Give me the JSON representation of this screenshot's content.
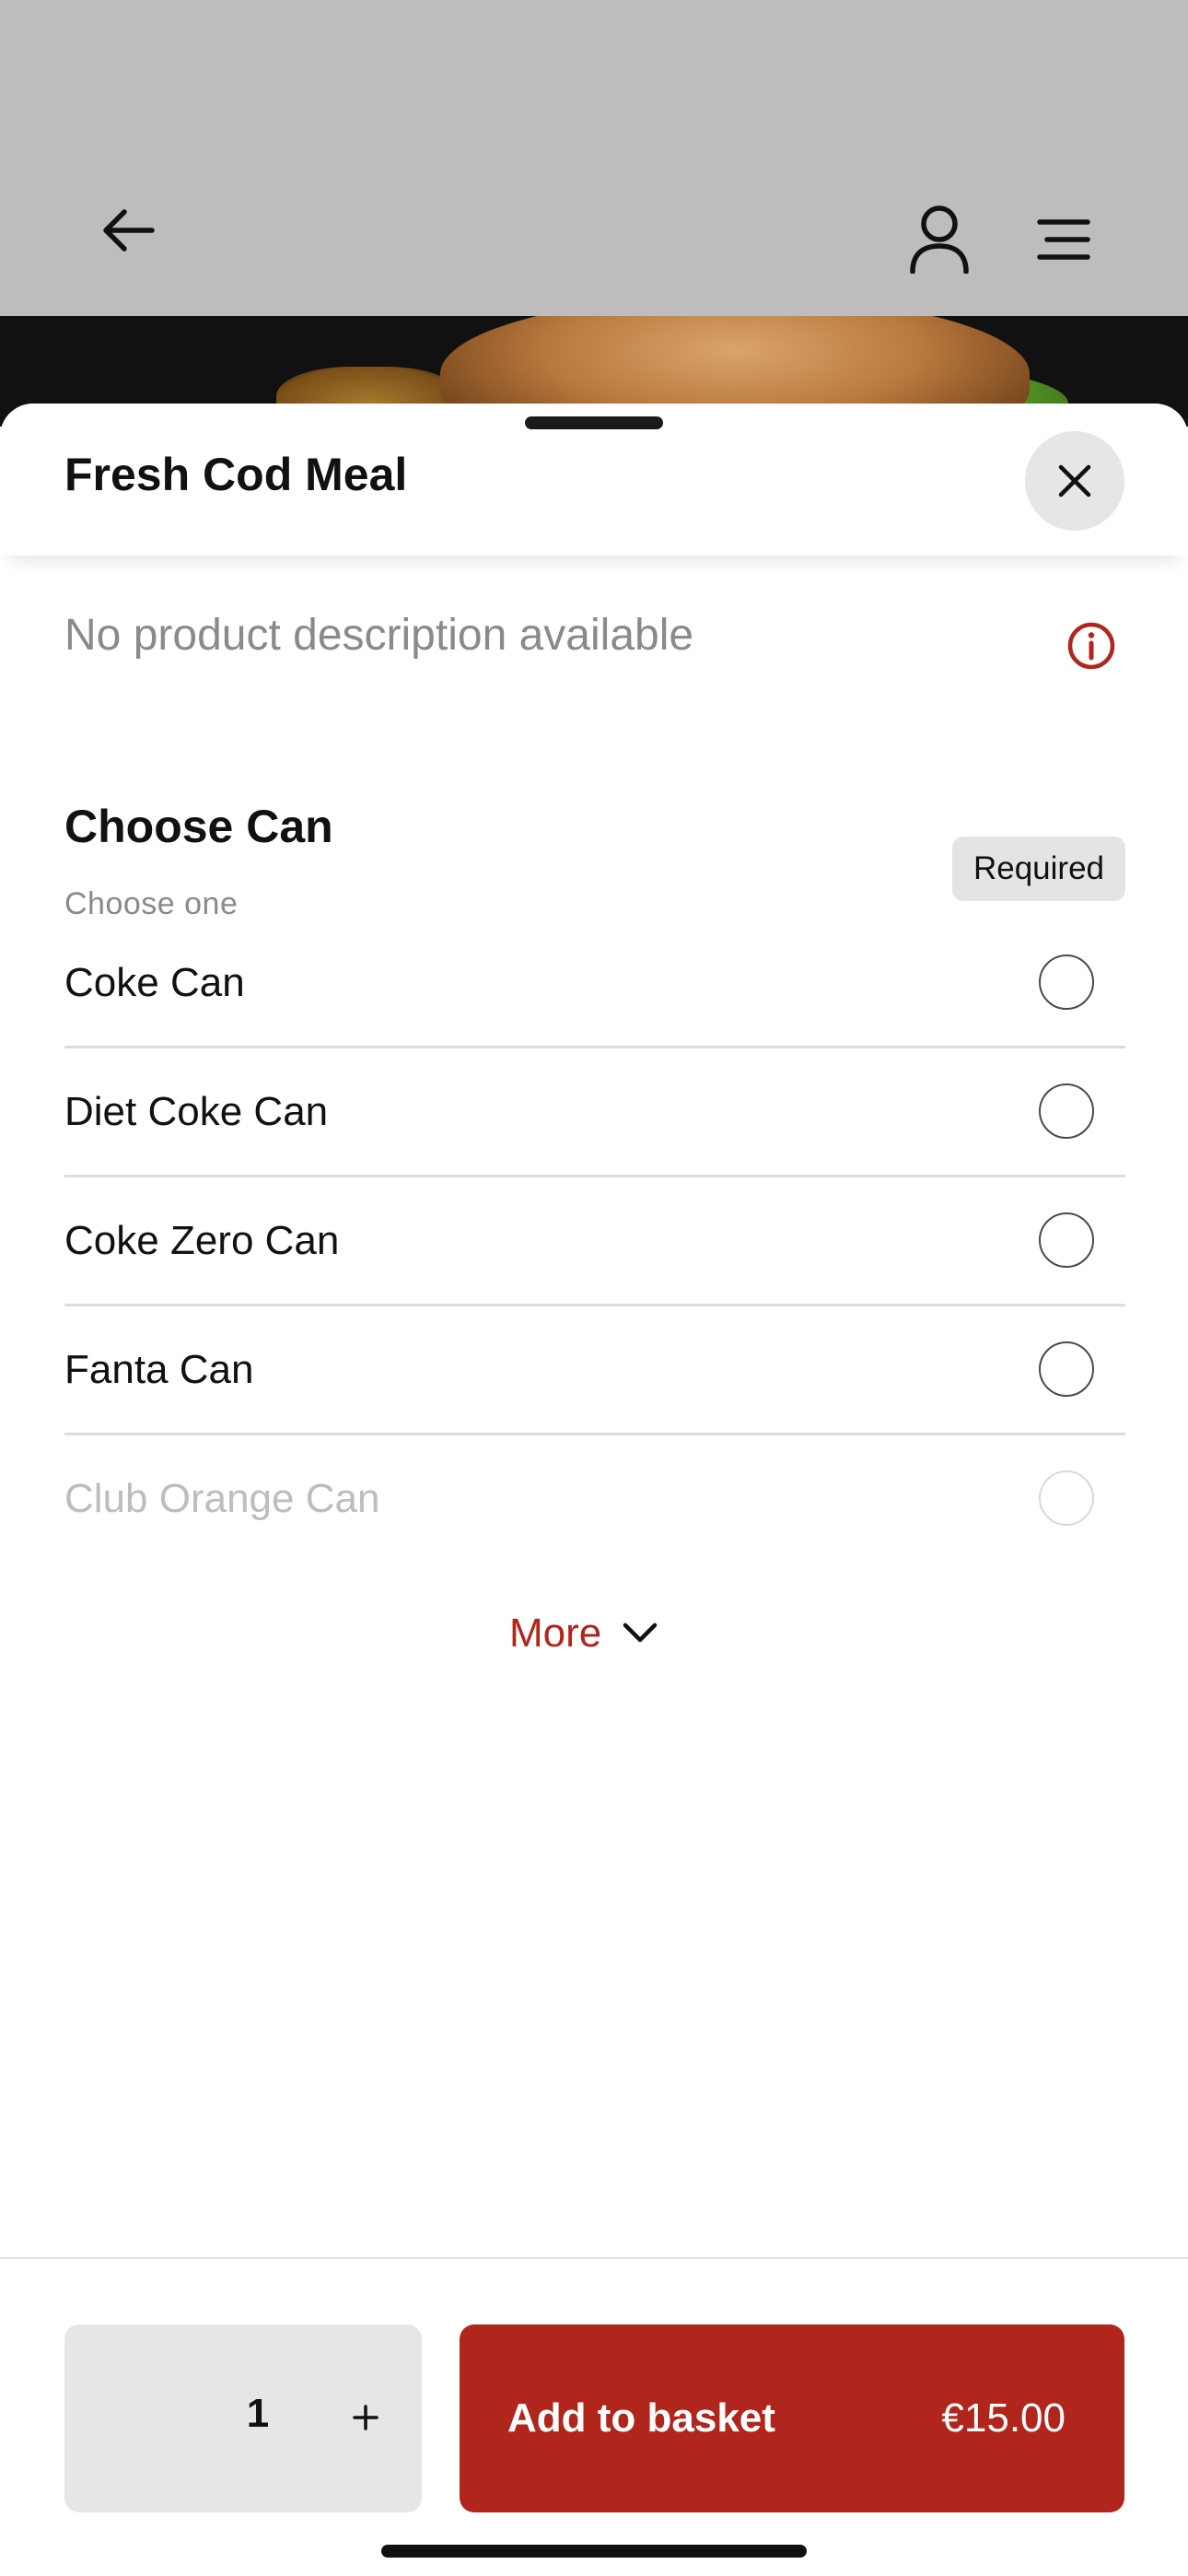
{
  "header": {
    "back_icon": "arrow-left-icon",
    "user_icon": "user-icon",
    "menu_icon": "hamburger-menu-icon"
  },
  "product": {
    "title": "Fresh Cod Meal",
    "description": "No product description available",
    "close_icon": "close-icon",
    "info_icon": "info-icon"
  },
  "group": {
    "title": "Choose Can",
    "subtitle": "Choose one",
    "badge": "Required",
    "options": [
      {
        "label": "Coke Can",
        "selected": false
      },
      {
        "label": "Diet Coke Can",
        "selected": false
      },
      {
        "label": "Coke Zero Can",
        "selected": false
      },
      {
        "label": "Fanta Can",
        "selected": false
      },
      {
        "label": "Club Orange Can",
        "selected": false
      }
    ],
    "more_label": "More",
    "more_icon": "chevron-down-icon"
  },
  "footer": {
    "quantity": "1",
    "plus_icon": "plus-icon",
    "add_label": "Add to basket",
    "price": "€15.00"
  },
  "colors": {
    "accent": "#b0261c",
    "header_bg": "#bdbdbd",
    "muted_text": "#8a8a8a"
  }
}
